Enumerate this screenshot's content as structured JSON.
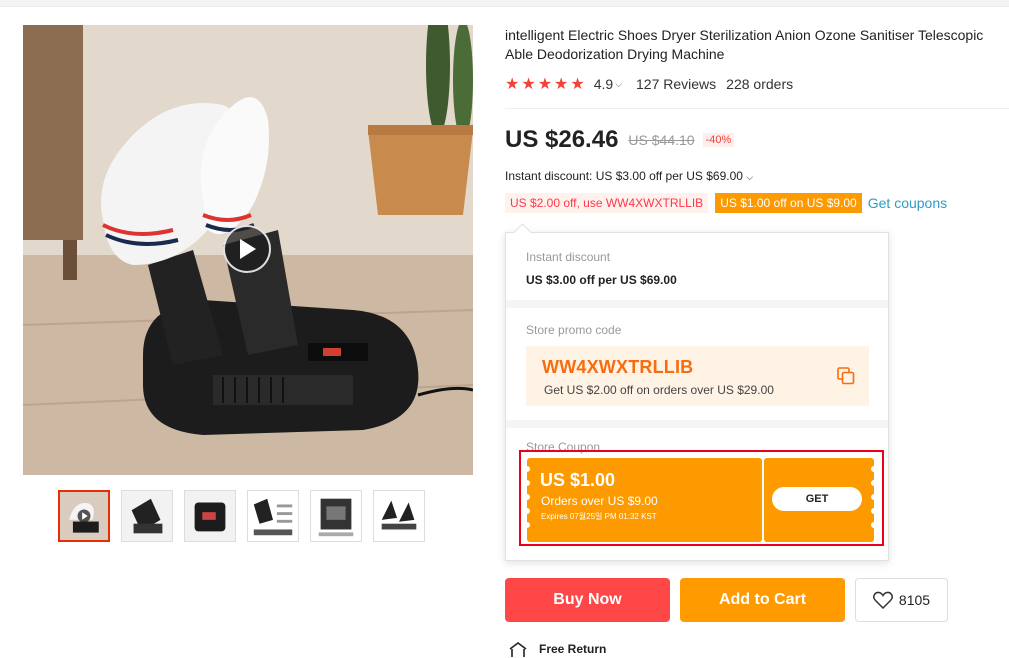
{
  "product": {
    "title": "intelligent Electric Shoes Dryer Sterilization Anion Ozone Sanitiser Telescopic Able Deodorization Drying Machine",
    "rating": "4.9",
    "reviews": "127 Reviews",
    "orders": "228 orders"
  },
  "price": {
    "current": "US $26.46",
    "original": "US $44.10",
    "discount": "-40%"
  },
  "instant_discount": "Instant discount: US $3.00 off per US $69.00",
  "coupon_tags": {
    "code_tag": "US $2.00 off, use WW4XWXTRLLIB",
    "coupon_tag": "US $1.00 off on US $9.00",
    "get_coupons": "Get coupons"
  },
  "popup": {
    "instant_label": "Instant discount",
    "instant_text": "US $3.00 off per US $69.00",
    "promo_label": "Store promo code",
    "promo_code": "WW4XWXTRLLIB",
    "promo_desc": "Get US $2.00 off on orders over US $29.00",
    "coupon_label": "Store Coupon",
    "coupon_amount": "US $1.00",
    "coupon_condition": "Orders over US $9.00",
    "coupon_expiry": "Expires 07월25일 PM 01:32 KST",
    "get_label": "GET"
  },
  "actions": {
    "buy_now": "Buy Now",
    "add_to_cart": "Add to Cart",
    "wishlist_count": "8105"
  },
  "free_return": "Free Return",
  "colors": {
    "buy_now": "#ff4747",
    "add_to_cart": "#ff9a00",
    "stars": "#f44336",
    "link": "#2e9cc3",
    "promo_code": "#f76d0e"
  }
}
